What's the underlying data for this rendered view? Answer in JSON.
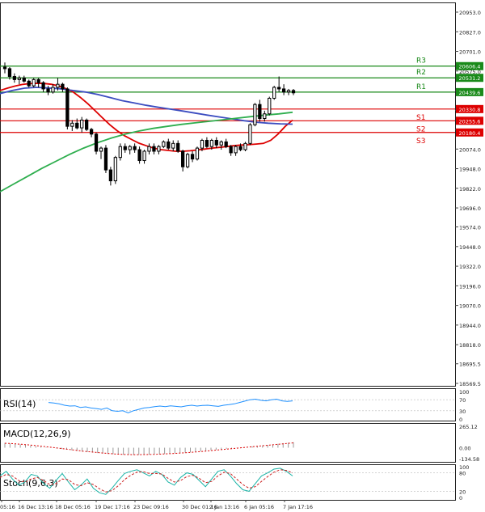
{
  "chart_data": [
    {
      "type": "candlestick",
      "title": "",
      "y_ticks": [
        "20953.0",
        "20827.0",
        "20701.0",
        "20575.0",
        "20449.0",
        "20323.0",
        "20197.0",
        "20074.0",
        "19948.0",
        "19822.0",
        "19696.0",
        "19574.0",
        "19448.0",
        "19322.0",
        "19196.0",
        "19070.0",
        "18944.0",
        "18818.0",
        "18695.5",
        "18569.5"
      ],
      "ylim": [
        18569.5,
        20953.0
      ],
      "x_ticks": [
        "05:16",
        "16 Dec 13:16",
        "18 Dec 05:16",
        "19 Dec 17:16",
        "23 Dec 09:16",
        "30 Dec 01:16",
        "2 Jan 13:16",
        "6 Jan 05:16",
        "7 Jan 17:16"
      ],
      "levels": [
        {
          "name": "R3",
          "value": 20606.4,
          "label": "20606.4",
          "color": "#1a8a1a"
        },
        {
          "name": "R2",
          "value": 20531.2,
          "label": "20531.2",
          "color": "#1a8a1a"
        },
        {
          "name": "R1",
          "value": 20439.6,
          "label": "20439.6",
          "color": "#1a8a1a"
        },
        {
          "name": "S1",
          "value": 20330.8,
          "label": "20330.8",
          "color": "#dd0000"
        },
        {
          "name": "S2",
          "value": 20255.6,
          "label": "20255.6",
          "color": "#dd0000"
        },
        {
          "name": "S3",
          "value": 20180.4,
          "label": "20180.4",
          "color": "#dd0000"
        }
      ],
      "candles": [
        {
          "o": 20600,
          "h": 20630,
          "l": 20560,
          "c": 20590
        },
        {
          "o": 20590,
          "h": 20600,
          "l": 20520,
          "c": 20540
        },
        {
          "o": 20540,
          "h": 20560,
          "l": 20500,
          "c": 20520
        },
        {
          "o": 20520,
          "h": 20545,
          "l": 20490,
          "c": 20530
        },
        {
          "o": 20530,
          "h": 20545,
          "l": 20500,
          "c": 20510
        },
        {
          "o": 20510,
          "h": 20520,
          "l": 20470,
          "c": 20480
        },
        {
          "o": 20480,
          "h": 20530,
          "l": 20470,
          "c": 20520
        },
        {
          "o": 20520,
          "h": 20530,
          "l": 20470,
          "c": 20500
        },
        {
          "o": 20500,
          "h": 20510,
          "l": 20440,
          "c": 20460
        },
        {
          "o": 20460,
          "h": 20480,
          "l": 20420,
          "c": 20440
        },
        {
          "o": 20440,
          "h": 20490,
          "l": 20430,
          "c": 20470
        },
        {
          "o": 20470,
          "h": 20530,
          "l": 20450,
          "c": 20490
        },
        {
          "o": 20490,
          "h": 20500,
          "l": 20440,
          "c": 20460
        },
        {
          "o": 20460,
          "h": 20470,
          "l": 20200,
          "c": 20220
        },
        {
          "o": 20220,
          "h": 20260,
          "l": 20190,
          "c": 20240
        },
        {
          "o": 20240,
          "h": 20270,
          "l": 20200,
          "c": 20210
        },
        {
          "o": 20210,
          "h": 20280,
          "l": 20180,
          "c": 20260
        },
        {
          "o": 20260,
          "h": 20270,
          "l": 20190,
          "c": 20200
        },
        {
          "o": 20200,
          "h": 20210,
          "l": 20150,
          "c": 20170
        },
        {
          "o": 20170,
          "h": 20180,
          "l": 20040,
          "c": 20060
        },
        {
          "o": 20060,
          "h": 20090,
          "l": 20010,
          "c": 20080
        },
        {
          "o": 20080,
          "h": 20100,
          "l": 19920,
          "c": 19940
        },
        {
          "o": 19940,
          "h": 19960,
          "l": 19840,
          "c": 19870
        },
        {
          "o": 19870,
          "h": 20030,
          "l": 19850,
          "c": 20020
        },
        {
          "o": 20020,
          "h": 20110,
          "l": 20000,
          "c": 20090
        },
        {
          "o": 20090,
          "h": 20110,
          "l": 20050,
          "c": 20070
        },
        {
          "o": 20070,
          "h": 20100,
          "l": 20040,
          "c": 20090
        },
        {
          "o": 20090,
          "h": 20110,
          "l": 20050,
          "c": 20070
        },
        {
          "o": 20070,
          "h": 20090,
          "l": 19980,
          "c": 20000
        },
        {
          "o": 20000,
          "h": 20070,
          "l": 19980,
          "c": 20060
        },
        {
          "o": 20060,
          "h": 20110,
          "l": 20040,
          "c": 20090
        },
        {
          "o": 20090,
          "h": 20110,
          "l": 20040,
          "c": 20060
        },
        {
          "o": 20060,
          "h": 20100,
          "l": 20040,
          "c": 20090
        },
        {
          "o": 20090,
          "h": 20130,
          "l": 20080,
          "c": 20120
        },
        {
          "o": 20120,
          "h": 20140,
          "l": 20070,
          "c": 20080
        },
        {
          "o": 20080,
          "h": 20130,
          "l": 20060,
          "c": 20110
        },
        {
          "o": 20110,
          "h": 20130,
          "l": 20050,
          "c": 20060
        },
        {
          "o": 20060,
          "h": 20070,
          "l": 19930,
          "c": 19960
        },
        {
          "o": 19960,
          "h": 20050,
          "l": 19950,
          "c": 20040
        },
        {
          "o": 20040,
          "h": 20060,
          "l": 19990,
          "c": 20010
        },
        {
          "o": 20010,
          "h": 20090,
          "l": 20000,
          "c": 20080
        },
        {
          "o": 20080,
          "h": 20140,
          "l": 20060,
          "c": 20130
        },
        {
          "o": 20130,
          "h": 20150,
          "l": 20080,
          "c": 20090
        },
        {
          "o": 20090,
          "h": 20140,
          "l": 20070,
          "c": 20130
        },
        {
          "o": 20130,
          "h": 20150,
          "l": 20080,
          "c": 20100
        },
        {
          "o": 20100,
          "h": 20130,
          "l": 20070,
          "c": 20120
        },
        {
          "o": 20120,
          "h": 20140,
          "l": 20080,
          "c": 20090
        },
        {
          "o": 20090,
          "h": 20100,
          "l": 20030,
          "c": 20050
        },
        {
          "o": 20050,
          "h": 20100,
          "l": 20030,
          "c": 20090
        },
        {
          "o": 20090,
          "h": 20110,
          "l": 20060,
          "c": 20070
        },
        {
          "o": 20070,
          "h": 20120,
          "l": 20060,
          "c": 20110
        },
        {
          "o": 20110,
          "h": 20240,
          "l": 20100,
          "c": 20230
        },
        {
          "o": 20230,
          "h": 20370,
          "l": 20220,
          "c": 20360
        },
        {
          "o": 20360,
          "h": 20390,
          "l": 20250,
          "c": 20270
        },
        {
          "o": 20270,
          "h": 20320,
          "l": 20250,
          "c": 20300
        },
        {
          "o": 20300,
          "h": 20410,
          "l": 20290,
          "c": 20400
        },
        {
          "o": 20400,
          "h": 20480,
          "l": 20390,
          "c": 20470
        },
        {
          "o": 20470,
          "h": 20540,
          "l": 20440,
          "c": 20460
        },
        {
          "o": 20460,
          "h": 20490,
          "l": 20420,
          "c": 20440
        },
        {
          "o": 20440,
          "h": 20460,
          "l": 20420,
          "c": 20450
        },
        {
          "o": 20450,
          "h": 20460,
          "l": 20420,
          "c": 20435
        }
      ],
      "series": [
        {
          "color": "#dd0000",
          "values": [
            20450,
            20465,
            20478,
            20488,
            20494,
            20496,
            20495,
            20490,
            20480,
            20462,
            20440,
            20405,
            20365,
            20320,
            20275,
            20230,
            20192,
            20160,
            20135,
            20112,
            20095,
            20080,
            20070,
            20065,
            20060,
            20060,
            20063,
            20068,
            20074,
            20080,
            20085,
            20090,
            20096,
            20100,
            20102,
            20106,
            20110,
            20130,
            20170,
            20220,
            20260
          ]
        },
        {
          "color": "#3b4cc0",
          "values": [
            20430,
            20450,
            20465,
            20470,
            20466,
            20460,
            20450,
            20440,
            20425,
            20405,
            20385,
            20370,
            20355,
            20342,
            20330,
            20318,
            20305,
            20292,
            20280,
            20268,
            20256,
            20246,
            20240,
            20236,
            20234
          ]
        },
        {
          "color": "#2eae4e",
          "values": [
            19800,
            19850,
            19900,
            19950,
            19995,
            20040,
            20080,
            20115,
            20145,
            20170,
            20190,
            20207,
            20220,
            20232,
            20242,
            20252,
            20262,
            20272,
            20282,
            20292,
            20300,
            20310
          ]
        }
      ]
    },
    {
      "type": "line",
      "title": "RSI(14)",
      "y_ticks": [
        "100",
        "70",
        "30",
        "0"
      ],
      "ylim": [
        0,
        100
      ],
      "series": [
        {
          "color": "#1e90ff",
          "values": [
            60,
            58,
            55,
            50,
            47,
            48,
            42,
            44,
            40,
            38,
            35,
            40,
            30,
            28,
            30,
            22,
            30,
            35,
            40,
            42,
            45,
            47,
            45,
            48,
            46,
            44,
            48,
            50,
            47,
            49,
            50,
            48,
            46,
            50,
            52,
            55,
            60,
            65,
            70,
            72,
            68,
            66,
            70,
            72,
            66,
            64,
            66
          ]
        }
      ]
    },
    {
      "type": "bar",
      "title": "MACD(12,26,9)",
      "y_ticks": [
        "265.12",
        "0.00",
        "-134.58"
      ],
      "ylim": [
        -134.58,
        265.12
      ],
      "values": [
        60,
        55,
        50,
        42,
        36,
        28,
        20,
        12,
        6,
        0,
        -8,
        -16,
        -24,
        -32,
        -40,
        -48,
        -54,
        -60,
        -66,
        -72,
        -76,
        -80,
        -84,
        -86,
        -88,
        -88,
        -88,
        -86,
        -84,
        -82,
        -80,
        -76,
        -72,
        -68,
        -64,
        -60,
        -56,
        -50,
        -44,
        -38,
        -32,
        -26,
        -20,
        -14,
        -8,
        -2,
        4,
        10,
        16,
        22,
        28,
        34,
        40,
        48,
        56,
        62,
        68
      ],
      "signal": [
        55,
        52,
        48,
        43,
        38,
        32,
        26,
        19,
        12,
        5,
        -2,
        -10,
        -18,
        -26,
        -34,
        -42,
        -48,
        -54,
        -60,
        -66,
        -71,
        -76,
        -80,
        -83,
        -85,
        -86,
        -86,
        -85,
        -84,
        -82,
        -80,
        -77,
        -74,
        -70,
        -66,
        -62,
        -58,
        -53,
        -48,
        -42,
        -36,
        -30,
        -24,
        -18,
        -12,
        -6,
        0,
        6,
        12,
        18,
        24,
        30,
        36,
        42,
        48,
        54,
        60
      ]
    },
    {
      "type": "line",
      "title": "Stoch(9,6,3)",
      "y_ticks": [
        "100",
        "80",
        "20",
        "0"
      ],
      "ylim": [
        0,
        100
      ],
      "series": [
        {
          "color": "#19b3a6",
          "values": [
            70,
            85,
            60,
            40,
            50,
            75,
            70,
            45,
            30,
            55,
            78,
            50,
            25,
            40,
            60,
            30,
            15,
            10,
            30,
            55,
            78,
            85,
            90,
            80,
            70,
            85,
            75,
            50,
            40,
            65,
            80,
            75,
            55,
            35,
            60,
            85,
            90,
            70,
            45,
            25,
            20,
            45,
            70,
            80,
            92,
            95,
            85,
            70
          ]
        },
        {
          "color": "#cc2222",
          "values": [
            65,
            75,
            70,
            55,
            50,
            60,
            65,
            55,
            42,
            45,
            60,
            58,
            42,
            38,
            48,
            42,
            28,
            18,
            22,
            38,
            58,
            72,
            82,
            84,
            78,
            78,
            76,
            62,
            50,
            55,
            68,
            72,
            62,
            48,
            52,
            70,
            82,
            78,
            60,
            42,
            30,
            35,
            52,
            68,
            82,
            90,
            88,
            80
          ]
        }
      ]
    }
  ],
  "indicators": {
    "rsi_label": "RSI(14)",
    "macd_label": "MACD(12,26,9)",
    "stoch_label": "Stoch(9,6,3)"
  }
}
